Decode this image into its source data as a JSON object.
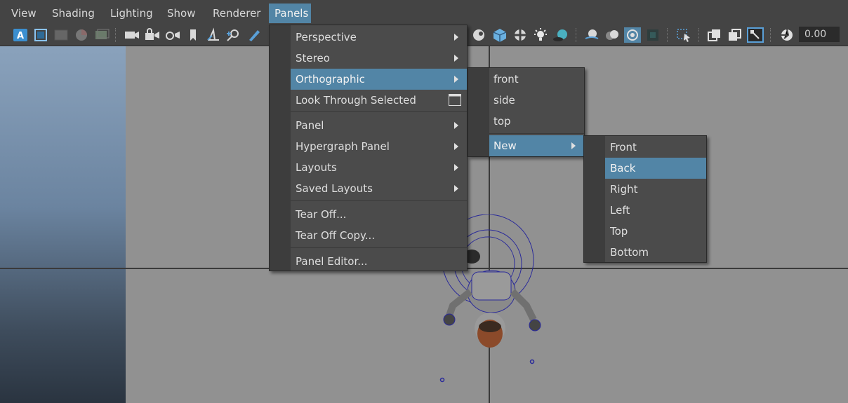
{
  "menubar": {
    "items": [
      "View",
      "Shading",
      "Lighting",
      "Show",
      "Renderer",
      "Panels"
    ],
    "active": "Panels"
  },
  "toolbar": {
    "value_field": "0.00",
    "icons": [
      "select-camera-icon",
      "camera-attributes-icon",
      "bookmark-icon",
      "image-plane-icon",
      "2d-pan-zoom-icon",
      "grease-pencil-icon",
      "wireframe-icon",
      "smooth-shade-icon",
      "xray-icon",
      "lights-icon",
      "shadows-icon",
      "isolate-select-icon",
      "exposure-icon"
    ]
  },
  "panels_menu": {
    "items": [
      {
        "label": "Perspective",
        "submenu": true
      },
      {
        "label": "Stereo",
        "submenu": true
      },
      {
        "label": "Orthographic",
        "submenu": true,
        "highlighted": true
      },
      {
        "label": "Look Through Selected",
        "option_box": true
      },
      {
        "label": "Panel",
        "submenu": true
      },
      {
        "label": "Hypergraph Panel",
        "submenu": true
      },
      {
        "label": "Layouts",
        "submenu": true
      },
      {
        "label": "Saved Layouts",
        "submenu": true
      },
      {
        "label": "Tear Off..."
      },
      {
        "label": "Tear Off Copy..."
      },
      {
        "label": "Panel Editor..."
      }
    ]
  },
  "orthographic_menu": {
    "items": [
      {
        "label": "front"
      },
      {
        "label": "side"
      },
      {
        "label": "top"
      },
      {
        "label": "New",
        "submenu": true,
        "highlighted": true
      }
    ]
  },
  "new_menu": {
    "items": [
      {
        "label": "Front"
      },
      {
        "label": "Back",
        "highlighted": true
      },
      {
        "label": "Right"
      },
      {
        "label": "Left"
      },
      {
        "label": "Top"
      },
      {
        "label": "Bottom"
      }
    ]
  },
  "colors": {
    "highlight": "#5285a6",
    "menu_bg": "#4b4b4b",
    "viewport_bg": "#919191"
  }
}
